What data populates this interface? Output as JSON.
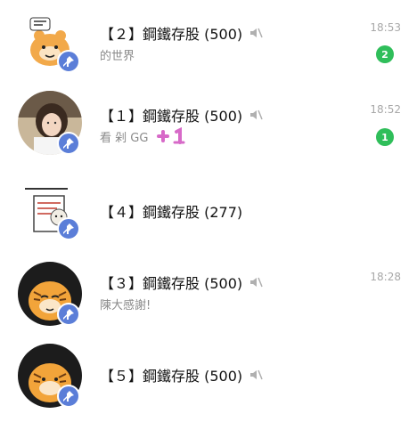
{
  "colors": {
    "unread_badge": "#2fbe5a",
    "pin_badge": "#5b7ed8",
    "time_text": "#a8a8a8",
    "preview_text": "#8a8a8a"
  },
  "chats": [
    {
      "title": "【２】鋼鐵存股 (500)",
      "muted": true,
      "preview": "的世界",
      "time": "18:53",
      "unread": "2",
      "pinned": true,
      "avatar": "bear-cartoon-icon"
    },
    {
      "title": "【１】鋼鐵存股 (500)",
      "muted": true,
      "preview": "看 剁 GG",
      "preview_sticker": "plus-one-sticker",
      "time": "18:52",
      "unread": "1",
      "pinned": true,
      "avatar": "photo-woman-avatar"
    },
    {
      "title": "【４】鋼鐵存股 (277)",
      "muted": false,
      "preview": "",
      "time": "",
      "unread": "",
      "pinned": true,
      "avatar": "sticker-cat-note-icon"
    },
    {
      "title": "【３】鋼鐵存股 (500)",
      "muted": true,
      "preview": "陳大感謝!",
      "time": "18:28",
      "unread": "",
      "pinned": true,
      "avatar": "tiger-cartoon-icon"
    },
    {
      "title": "【５】鋼鐵存股 (500)",
      "muted": true,
      "preview": "",
      "time": "",
      "unread": "",
      "pinned": true,
      "avatar": "tiger-cartoon-icon"
    }
  ]
}
